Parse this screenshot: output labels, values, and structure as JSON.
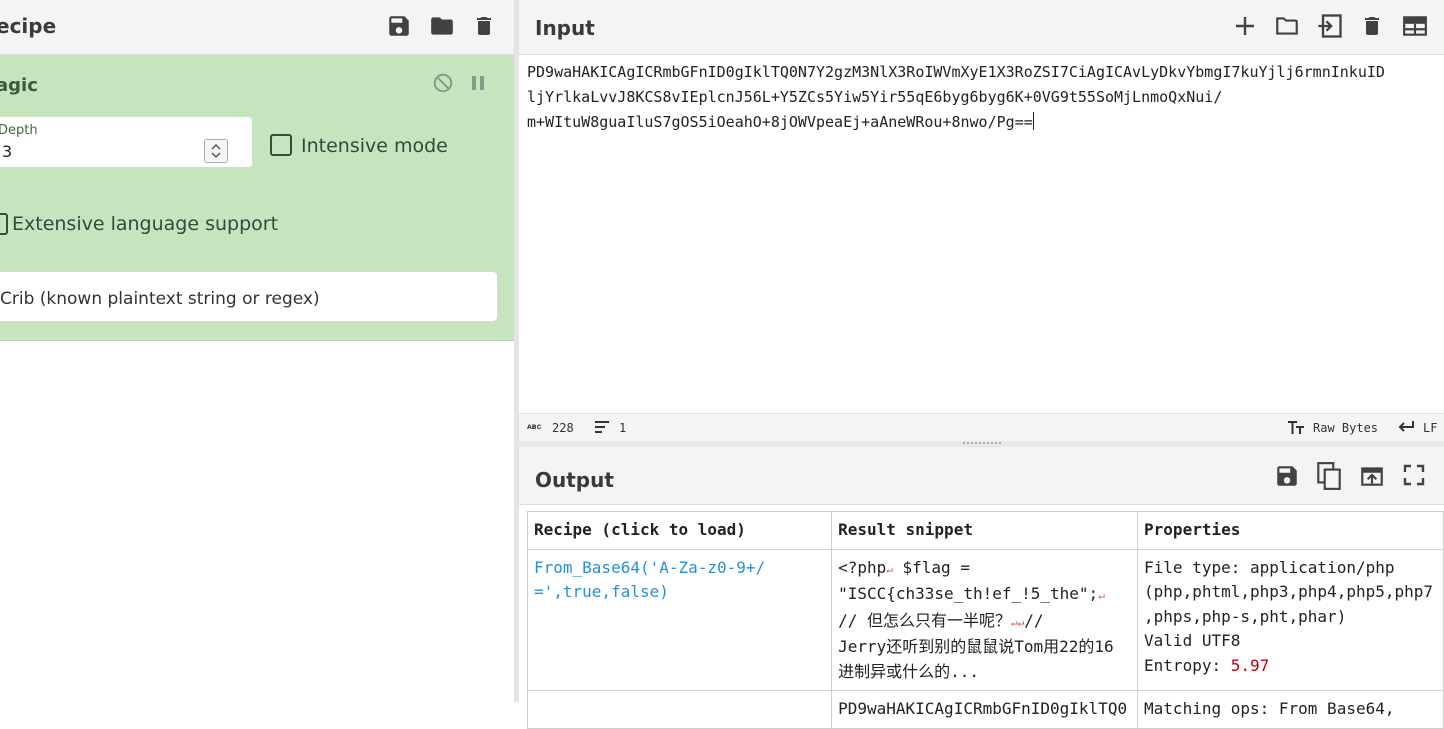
{
  "recipe": {
    "title": "Recipe",
    "title_visible": "ecipe",
    "icons": [
      "save-icon",
      "folder-icon",
      "trash-icon"
    ],
    "operation": {
      "name": "Magic",
      "name_visible": "agic",
      "icons": [
        "disable-icon",
        "pause-icon"
      ],
      "depth_label": "Depth",
      "depth_label_visible": "Depth",
      "depth_value": "3",
      "intensive_mode_label": "Intensive mode",
      "extensive_language_label": "Extensive language support",
      "crib_placeholder": "Crib (known plaintext string or regex)"
    }
  },
  "input": {
    "title": "Input",
    "icons": [
      "add-icon",
      "open-folder-icon",
      "import-icon",
      "trash-icon",
      "layout-icon"
    ],
    "lines": [
      "PD9waHAKICAgICRmbGFnID0gIklTQ0N7Y2gzM3NlX3RoIWVmXyE1X3RoZSI7CiAgICAvLyDkvYbmgI7kuYjlj6rmnInkuID",
      "ljYrlkaLvvJ8KCS8vIEplcnJ56L+Y5ZCs5Yiw5Yir55qE6byg6byg6K+0VG9t55SoMjLnmoQxNui/",
      "m+WItuW8guaIluS7gOS5iOeahO+8jOWVpeaEj+aAneWRou+8nwo/Pg=="
    ],
    "status": {
      "char_count_icon": "abc-icon",
      "char_count": "228",
      "line_count": "1",
      "encoding": "Raw Bytes",
      "eol": "LF"
    }
  },
  "output": {
    "title": "Output",
    "icons": [
      "save-icon",
      "copy-icon",
      "replace-input-icon",
      "maximize-icon"
    ],
    "table": {
      "headers": [
        "Recipe (click to load)",
        "Result snippet",
        "Properties"
      ],
      "rows": [
        {
          "recipe_lines": [
            "From_Base64('A-Za-z0-9+/",
            "=',true,false)"
          ],
          "snippet_lines": [
            "<?php␊    $flag =",
            "\"ISCC{ch33se_th!ef_!5_the\";␊",
            "  // 但怎么只有一半呢？␊␊//",
            "Jerry还听到别的鼠鼠说Tom用22的16",
            "进制异或什么的..."
          ],
          "properties_lines": [
            "File type: application/php",
            "(php,phtml,php3,php4,php5,php7",
            ",phps,php-s,pht,phar)",
            "Valid UTF8"
          ],
          "entropy_label": "Entropy: ",
          "entropy_value": "5.97"
        },
        {
          "snippet_partial": "PD9waHAKICAgICRmbGFnID0gIklTQ0",
          "properties_partial": "Matching ops: From Base64,"
        }
      ]
    }
  }
}
